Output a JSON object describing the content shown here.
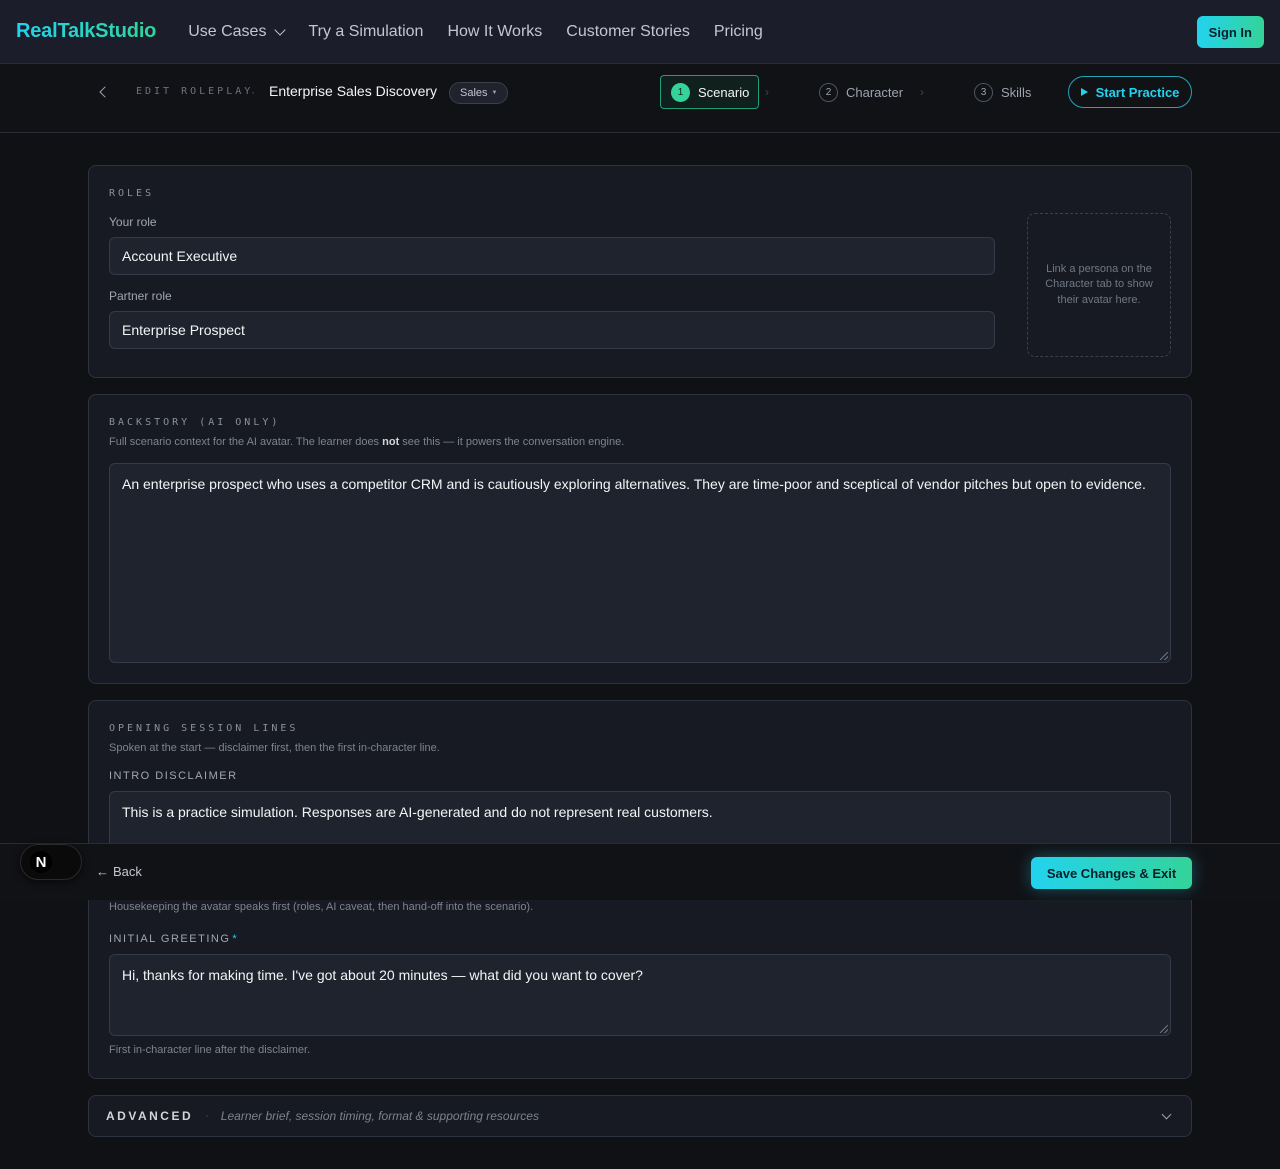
{
  "nav": {
    "brand": "RealTalkStudio",
    "links": [
      "Use Cases",
      "Try a Simulation",
      "How It Works",
      "Customer Stories",
      "Pricing"
    ],
    "signin": "Sign In"
  },
  "editor": {
    "label": "EDIT ROLEPLAY",
    "separator": "·",
    "title": "Enterprise Sales Discovery",
    "tag": "Sales",
    "steps": [
      {
        "num": "1",
        "label": "Scenario"
      },
      {
        "num": "2",
        "label": "Character"
      },
      {
        "num": "3",
        "label": "Skills"
      }
    ],
    "start_practice": "Start Practice"
  },
  "roles": {
    "heading": "ROLES",
    "your_role_label": "Your role",
    "your_role_value": "Account Executive",
    "partner_role_label": "Partner role",
    "partner_role_value": "Enterprise Prospect",
    "avatar_hint": "Link a persona on the Character tab to show their avatar here."
  },
  "backstory": {
    "heading": "BACKSTORY (AI ONLY)",
    "helper_pre": "Full scenario context for the AI avatar. The learner does ",
    "helper_bold": "not",
    "helper_post": " see this — it powers the conversation engine.",
    "value": "An enterprise prospect who uses a competitor CRM and is cautiously exploring alternatives. They are time-poor and sceptical of vendor pitches but open to evidence."
  },
  "opening": {
    "heading": "OPENING SESSION LINES",
    "helper": "Spoken at the start — disclaimer first, then the first in-character line.",
    "intro_label": "INTRO DISCLAIMER",
    "intro_value": "This is a practice simulation. Responses are AI-generated and do not represent real customers.",
    "intro_helper": "Housekeeping the avatar speaks first (roles, AI caveat, then hand-off into the scenario).",
    "greeting_label": "INITIAL GREETING",
    "greeting_required": "*",
    "greeting_value": "Hi, thanks for making time. I've got about 20 minutes — what did you want to cover?",
    "greeting_helper": "First in-character line after the disclaimer."
  },
  "advanced": {
    "title": "ADVANCED",
    "dot": "·",
    "description": "Learner brief, session timing, format & supporting resources"
  },
  "footer": {
    "back": "Back",
    "back_arrow": "←",
    "save": "Save Changes & Exit",
    "dev_badge": "N"
  }
}
